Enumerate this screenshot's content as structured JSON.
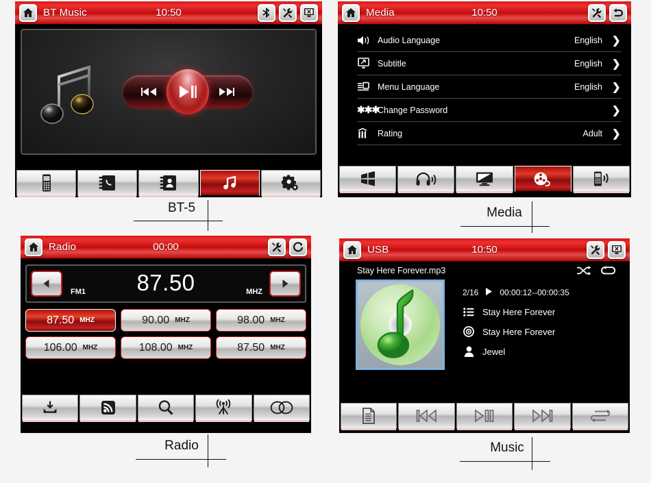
{
  "panels": {
    "bt": {
      "title": "BT Music",
      "clock": "10:50",
      "caption": "BT-5",
      "titlebar_icons": [
        "home-icon",
        "bluetooth-icon",
        "tools-icon",
        "screen-off-icon"
      ],
      "transport": [
        "previous-track-button",
        "play-pause-button",
        "next-track-button"
      ],
      "toolbar": [
        {
          "icon": "mobile-phone-icon",
          "active": false
        },
        {
          "icon": "call-log-book-icon",
          "active": false
        },
        {
          "icon": "contacts-book-icon",
          "active": false
        },
        {
          "icon": "music-note-icon",
          "active": true
        },
        {
          "icon": "settings-gear-icon",
          "active": false
        }
      ]
    },
    "media": {
      "title": "Media",
      "clock": "10:50",
      "caption": "Media",
      "titlebar_icons": [
        "home-icon",
        "tools-icon",
        "back-icon"
      ],
      "rows": [
        {
          "icon": "speaker-icon",
          "label": "Audio  Language",
          "value": "English",
          "chevron": "❯"
        },
        {
          "icon": "subtitle-icon",
          "label": "Subtitle",
          "value": "English",
          "chevron": "❯"
        },
        {
          "icon": "menu-list-icon",
          "label": "Menu Language",
          "value": "English",
          "chevron": "❯"
        },
        {
          "icon": "asterisks-icon",
          "label": "Change Password",
          "value": "",
          "chevron": "❯"
        },
        {
          "icon": "rating-icon",
          "label": "Rating",
          "value": "Adult",
          "chevron": "❯"
        }
      ],
      "toolbar": [
        {
          "icon": "windows-icon",
          "active": false
        },
        {
          "icon": "headphones-icon",
          "active": false
        },
        {
          "icon": "monitor-icon",
          "active": false
        },
        {
          "icon": "film-reel-icon",
          "active": true
        },
        {
          "icon": "phone-signal-icon",
          "active": false
        }
      ]
    },
    "radio": {
      "title": "Radio",
      "clock": "00:00",
      "caption": "Radio",
      "titlebar_icons": [
        "home-icon",
        "tools-icon",
        "refresh-icon"
      ],
      "tuner": {
        "prev_icon": "left-arrow-icon",
        "next_icon": "right-arrow-icon",
        "band": "FM1",
        "frequency": "87.50",
        "unit": "MHZ"
      },
      "presets": [
        {
          "freq": "87.50",
          "unit": "MHZ",
          "active": true
        },
        {
          "freq": "90.00",
          "unit": "MHZ",
          "active": false
        },
        {
          "freq": "98.00",
          "unit": "MHZ",
          "active": false
        },
        {
          "freq": "106.00",
          "unit": "MHZ",
          "active": false
        },
        {
          "freq": "108.00",
          "unit": "MHZ",
          "active": false
        },
        {
          "freq": "87.50",
          "unit": "MHZ",
          "active": false
        }
      ],
      "toolbar": [
        {
          "icon": "save-preset-icon",
          "active": false
        },
        {
          "icon": "rss-signal-icon",
          "active": false
        },
        {
          "icon": "search-icon",
          "active": false
        },
        {
          "icon": "antenna-icon",
          "active": false
        },
        {
          "icon": "stereo-icon",
          "active": false
        }
      ]
    },
    "usb": {
      "title": "USB",
      "clock": "10:50",
      "caption": "Music",
      "titlebar_icons": [
        "home-icon",
        "tools-icon",
        "screen-off-icon"
      ],
      "filename": "Stay Here Forever.mp3",
      "modes": [
        "shuffle-icon",
        "repeat-icon"
      ],
      "track_index": "2/16",
      "play_state_icon": "play-icon",
      "time": "00:00:12--00:00:35",
      "meta": [
        {
          "icon": "playlist-icon",
          "value": "Stay Here Forever"
        },
        {
          "icon": "album-disc-icon",
          "value": "Stay Here Forever"
        },
        {
          "icon": "artist-icon",
          "value": "Jewel"
        }
      ],
      "album_art_icon": "green-music-note-cd-icon",
      "toolbar": [
        {
          "icon": "file-list-icon",
          "active": false
        },
        {
          "icon": "previous-track-icon",
          "active": false
        },
        {
          "icon": "play-pause-icon",
          "active": false
        },
        {
          "icon": "next-track-icon",
          "active": false
        },
        {
          "icon": "repeat-all-icon",
          "active": false
        }
      ]
    }
  },
  "colors": {
    "accent_red": "#c41515",
    "page_background": "#f4f4f4",
    "screen_black": "#000000",
    "text_white": "#ffffff"
  }
}
